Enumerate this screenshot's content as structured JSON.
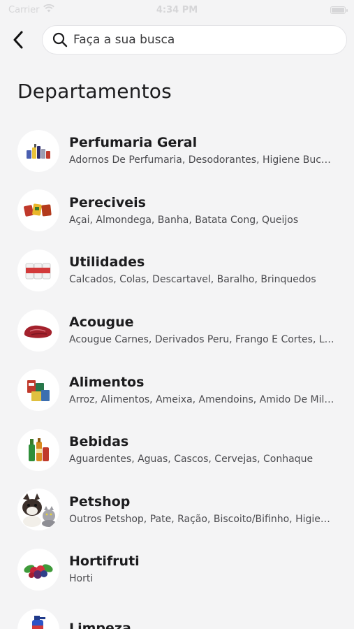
{
  "status_bar": {
    "carrier": "Carrier",
    "time": "4:34 PM"
  },
  "search": {
    "placeholder": "Faça a sua busca",
    "value": ""
  },
  "page": {
    "title": "Departamentos"
  },
  "departments": [
    {
      "name": "Perfumaria Geral",
      "subcategories": "Adornos De Perfumaria, Desodorantes, Higiene Buc…",
      "icon": "perfume-products-icon"
    },
    {
      "name": "Pereciveis",
      "subcategories": "Açai, Almondega, Banha, Batata Cong, Queijos",
      "icon": "perishables-icon"
    },
    {
      "name": "Utilidades",
      "subcategories": "Calcados, Colas, Descartavel, Baralho, Brinquedos",
      "icon": "utilities-icon"
    },
    {
      "name": "Acougue",
      "subcategories": "Acougue Carnes, Derivados Peru, Frango E Cortes, L…",
      "icon": "meat-icon"
    },
    {
      "name": "Alimentos",
      "subcategories": "Arroz, Alimentos, Ameixa, Amendoins, Amido De Mil…",
      "icon": "groceries-icon"
    },
    {
      "name": "Bebidas",
      "subcategories": "Aguardentes, Aguas, Cascos, Cervejas, Conhaque",
      "icon": "beverages-icon"
    },
    {
      "name": "Petshop",
      "subcategories": "Outros Petshop, Pate, Ração, Biscoito/Bifinho, Higie…",
      "icon": "pets-icon"
    },
    {
      "name": "Hortifruti",
      "subcategories": "Horti",
      "icon": "produce-icon"
    },
    {
      "name": "Limpeza",
      "subcategories": "",
      "icon": "cleaning-icon"
    }
  ]
}
